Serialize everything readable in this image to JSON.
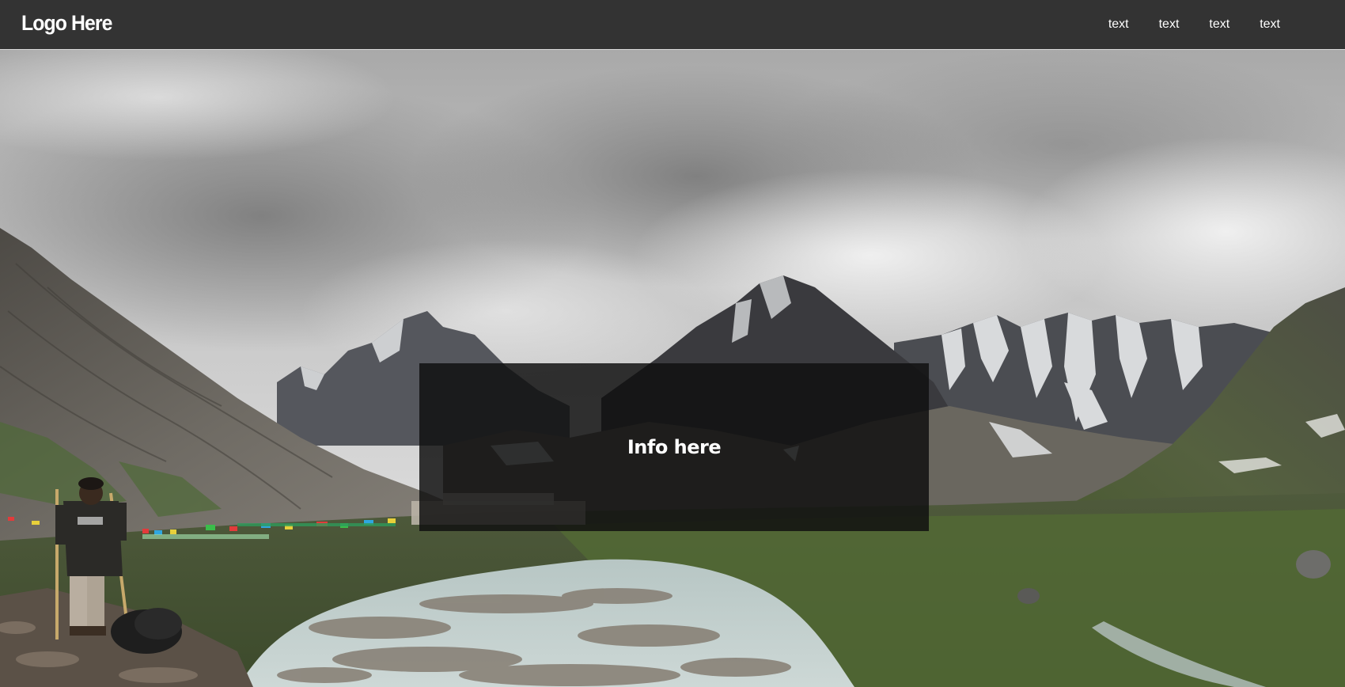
{
  "header": {
    "logo_text": "Logo Here",
    "nav": [
      {
        "label": "text"
      },
      {
        "label": "text"
      },
      {
        "label": "text"
      },
      {
        "label": "text"
      }
    ]
  },
  "hero": {
    "info_text": "Info here",
    "image": "mountain-valley-landscape-photo"
  },
  "colors": {
    "navbar_bg": "#333333",
    "overlay_bg": "#0f0f0f",
    "text": "#ffffff"
  }
}
